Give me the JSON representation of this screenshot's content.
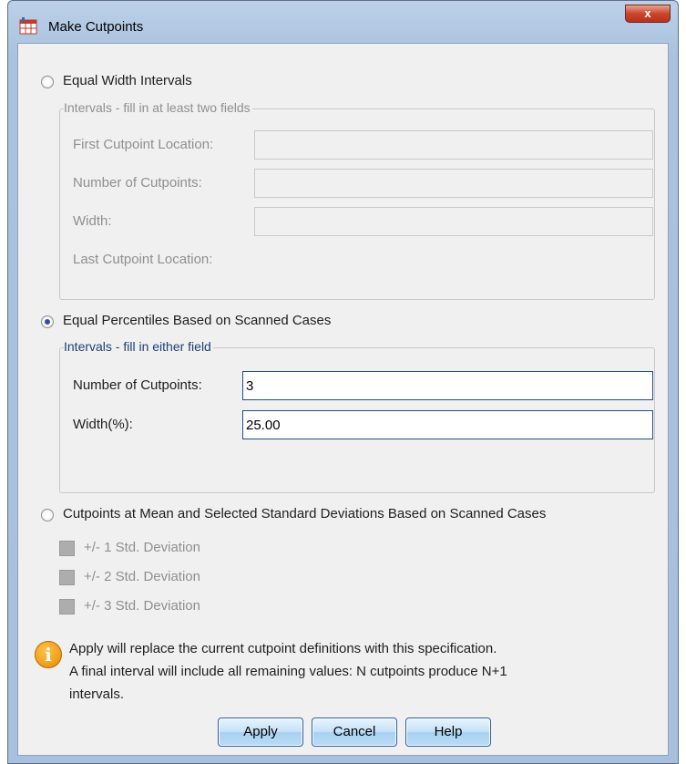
{
  "window": {
    "title": "Make Cutpoints",
    "close_glyph": "x"
  },
  "equal_width": {
    "radio_label": "Equal Width Intervals",
    "group_label": "Intervals - fill in at least two fields",
    "first_cutpoint_label": "First Cutpoint Location:",
    "first_cutpoint_value": "",
    "number_of_cutpoints_label": "Number of Cutpoints:",
    "number_of_cutpoints_value": "",
    "width_label": "Width:",
    "width_value": "",
    "last_cutpoint_label": "Last Cutpoint Location:"
  },
  "equal_percentiles": {
    "radio_label": "Equal Percentiles Based on Scanned Cases",
    "selected": true,
    "group_label": "Intervals - fill in either field",
    "number_of_cutpoints_label": "Number of Cutpoints:",
    "number_of_cutpoints_value": "3",
    "width_label": "Width(%):",
    "width_value": "25.00"
  },
  "mean_sd": {
    "radio_label": "Cutpoints at Mean and Selected Standard Deviations Based on Scanned Cases",
    "options": [
      {
        "label": "+/- 1 Std. Deviation",
        "checked": false
      },
      {
        "label": "+/- 2 Std. Deviation",
        "checked": false
      },
      {
        "label": "+/- 3 Std. Deviation",
        "checked": false
      }
    ]
  },
  "info": {
    "icon": "info-icon",
    "line1": "Apply will replace the current cutpoint definitions with this specification.",
    "line2": "A final interval will include all remaining values: N cutpoints produce N+1",
    "line3": "intervals."
  },
  "buttons": {
    "apply": "Apply",
    "cancel": "Cancel",
    "help": "Help"
  },
  "colors": {
    "title_bar": "#a9c2df",
    "accent_border": "#1f4f88",
    "legend_active": "#1f3f73",
    "button_face": "#c4e1f8"
  }
}
